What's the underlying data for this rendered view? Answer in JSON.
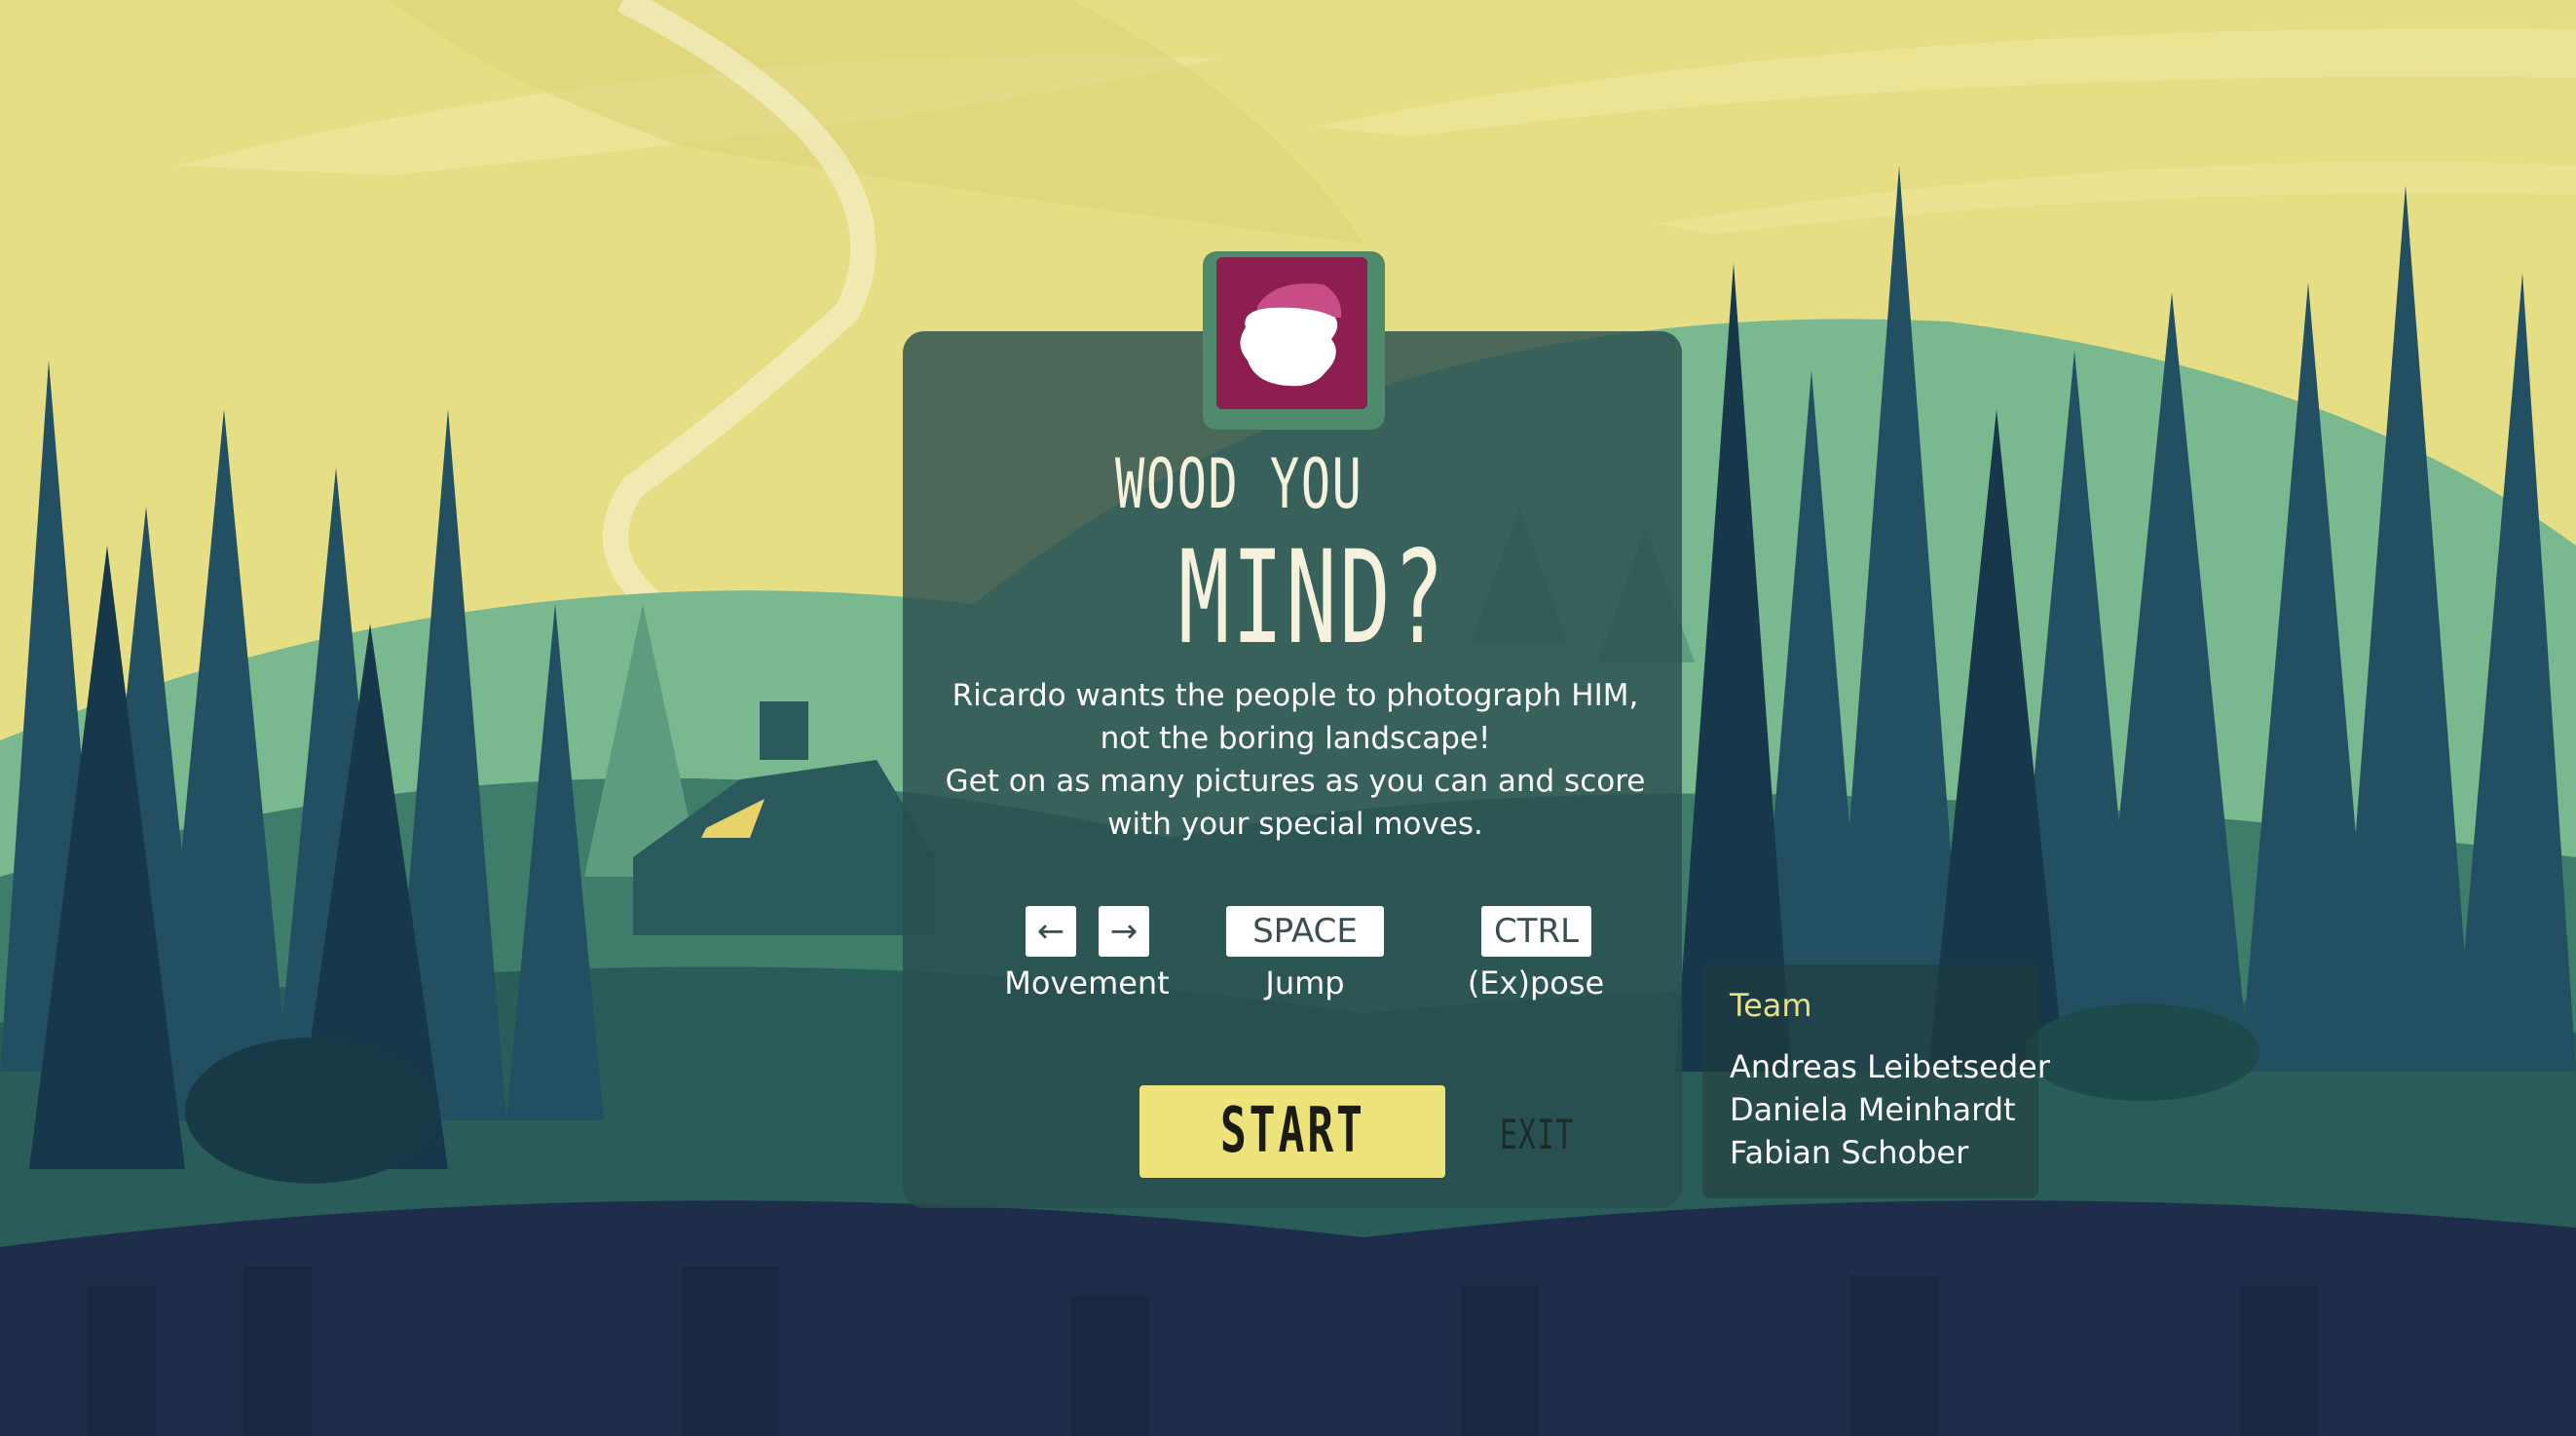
{
  "game": {
    "title_line1": "WOOD YOU",
    "title_line2": "MIND?",
    "description": [
      "Ricardo wants the people to photograph HIM,",
      "not the boring landscape!",
      "Get on as many pictures as you can and score",
      "with your special moves."
    ]
  },
  "controls": {
    "movement": {
      "keys": [
        "←",
        "→"
      ],
      "label": "Movement"
    },
    "jump": {
      "key": "SPACE",
      "label": "Jump"
    },
    "expose": {
      "key": "CTRL",
      "label": "(Ex)pose"
    }
  },
  "buttons": {
    "start": "START",
    "exit": "EXIT"
  },
  "team": {
    "heading": "Team",
    "members": [
      "Andreas Leibetseder",
      "Daniela Meinhardt",
      "Fabian Schober"
    ]
  },
  "colors": {
    "sky": "#e8e08a",
    "panel": "#284e4e",
    "avatar_bg": "#8c1f4f",
    "start_button": "#ece47a",
    "team_heading": "#e8e08a"
  },
  "icons": {
    "avatar": "ricardo-face-icon"
  }
}
